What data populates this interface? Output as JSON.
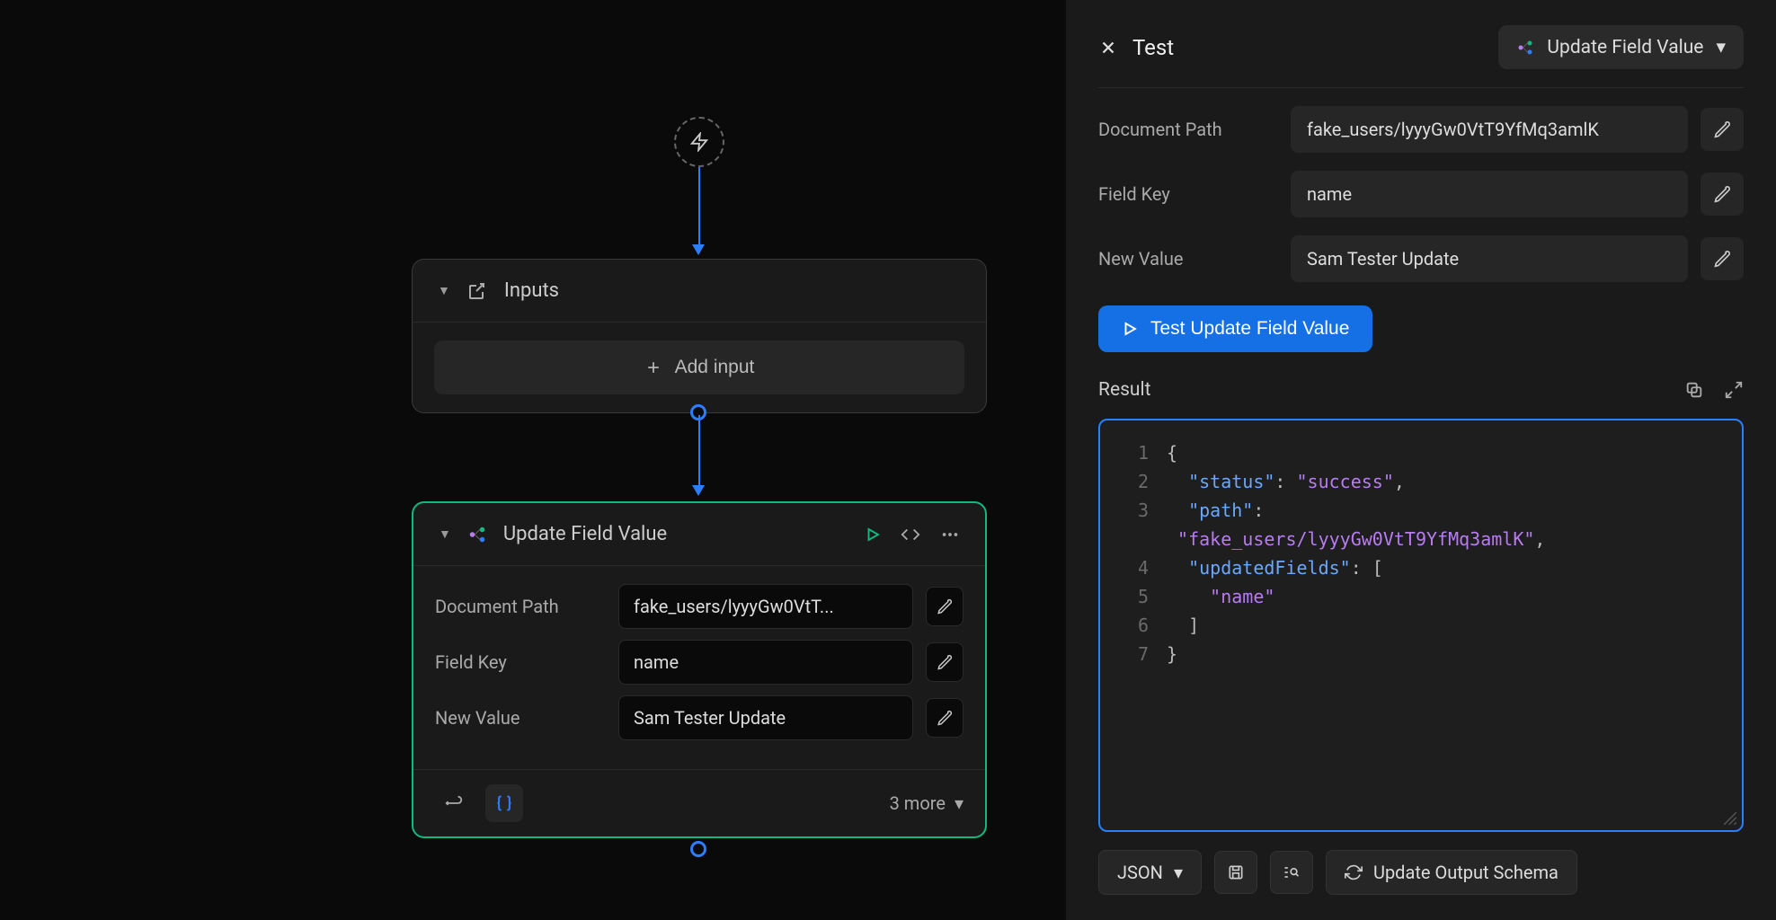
{
  "canvas": {
    "inputs_node": {
      "title": "Inputs",
      "add_input_label": "Add input"
    },
    "action_node": {
      "title": "Update Field Value",
      "fields": {
        "doc_path_label": "Document Path",
        "doc_path_value": "fake_users/lyyyGw0VtT...",
        "field_key_label": "Field Key",
        "field_key_value": "name",
        "new_value_label": "New Value",
        "new_value_value": "Sam Tester Update"
      },
      "footer_more": "3 more"
    }
  },
  "sidebar": {
    "title": "Test",
    "action_selector": "Update Field Value",
    "fields": {
      "doc_path_label": "Document Path",
      "doc_path_value": "fake_users/lyyyGw0VtT9YfMq3amlK",
      "field_key_label": "Field Key",
      "field_key_value": "name",
      "new_value_label": "New Value",
      "new_value_value": "Sam Tester Update"
    },
    "test_button": "Test Update Field Value",
    "result_label": "Result",
    "result_lines": [
      {
        "n": "1",
        "html": "<span class='tok-brace'>{</span>"
      },
      {
        "n": "2",
        "html": "&nbsp;&nbsp;<span class='tok-key'>\"status\"</span><span class='tok-punc'>: </span><span class='tok-str'>\"success\"</span><span class='tok-punc'>,</span>"
      },
      {
        "n": "3",
        "html": "&nbsp;&nbsp;<span class='tok-key'>\"path\"</span><span class='tok-punc'>:</span>"
      },
      {
        "n": "",
        "html": "&nbsp;<span class='tok-str'>\"fake_users/lyyyGw0VtT9YfMq3amlK\"</span><span class='tok-punc'>,</span>"
      },
      {
        "n": "4",
        "html": "&nbsp;&nbsp;<span class='tok-key'>\"updatedFields\"</span><span class='tok-punc'>: [</span>"
      },
      {
        "n": "5",
        "html": "&nbsp;&nbsp;&nbsp;&nbsp;<span class='tok-str'>\"name\"</span>"
      },
      {
        "n": "6",
        "html": "&nbsp;&nbsp;<span class='tok-punc'>]</span>"
      },
      {
        "n": "7",
        "html": "<span class='tok-brace'>}</span>"
      }
    ],
    "bottom": {
      "format": "JSON",
      "update_schema": "Update Output Schema"
    }
  }
}
